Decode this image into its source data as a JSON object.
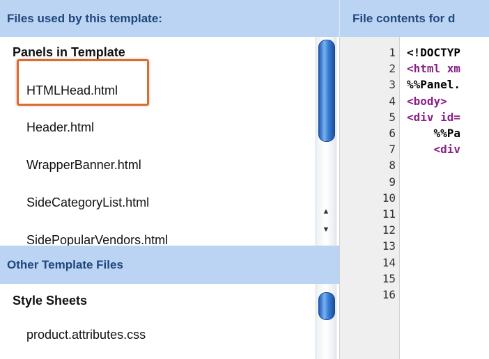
{
  "left_header": "Files used by this template:",
  "right_header": "File contents for d",
  "panels_section": {
    "title": "Panels in Template",
    "files": [
      "HTMLHead.html",
      "Header.html",
      "WrapperBanner.html",
      "SideCategoryList.html",
      "SidePopularVendors.html"
    ]
  },
  "other_header": "Other Template Files",
  "other_section": {
    "title": "Style Sheets",
    "files": [
      "product.attributes.css"
    ]
  },
  "line_numbers": [
    "1",
    "2",
    "3",
    "4",
    "5",
    "6",
    "7",
    "8",
    "9",
    "10",
    "11",
    "12",
    "13",
    "14",
    "15",
    "16"
  ],
  "code_lines": [
    {
      "text": "<!DOCTYP",
      "style": "plain"
    },
    {
      "text": "<html xm",
      "style": "tag"
    },
    {
      "text": "%%Panel.",
      "style": "plain"
    },
    {
      "text": "<body>",
      "style": "tag"
    },
    {
      "text": "<div id=",
      "style": "tag"
    },
    {
      "text": "    %%Pa",
      "style": "plain"
    },
    {
      "text": "    <div",
      "style": "tag"
    }
  ]
}
